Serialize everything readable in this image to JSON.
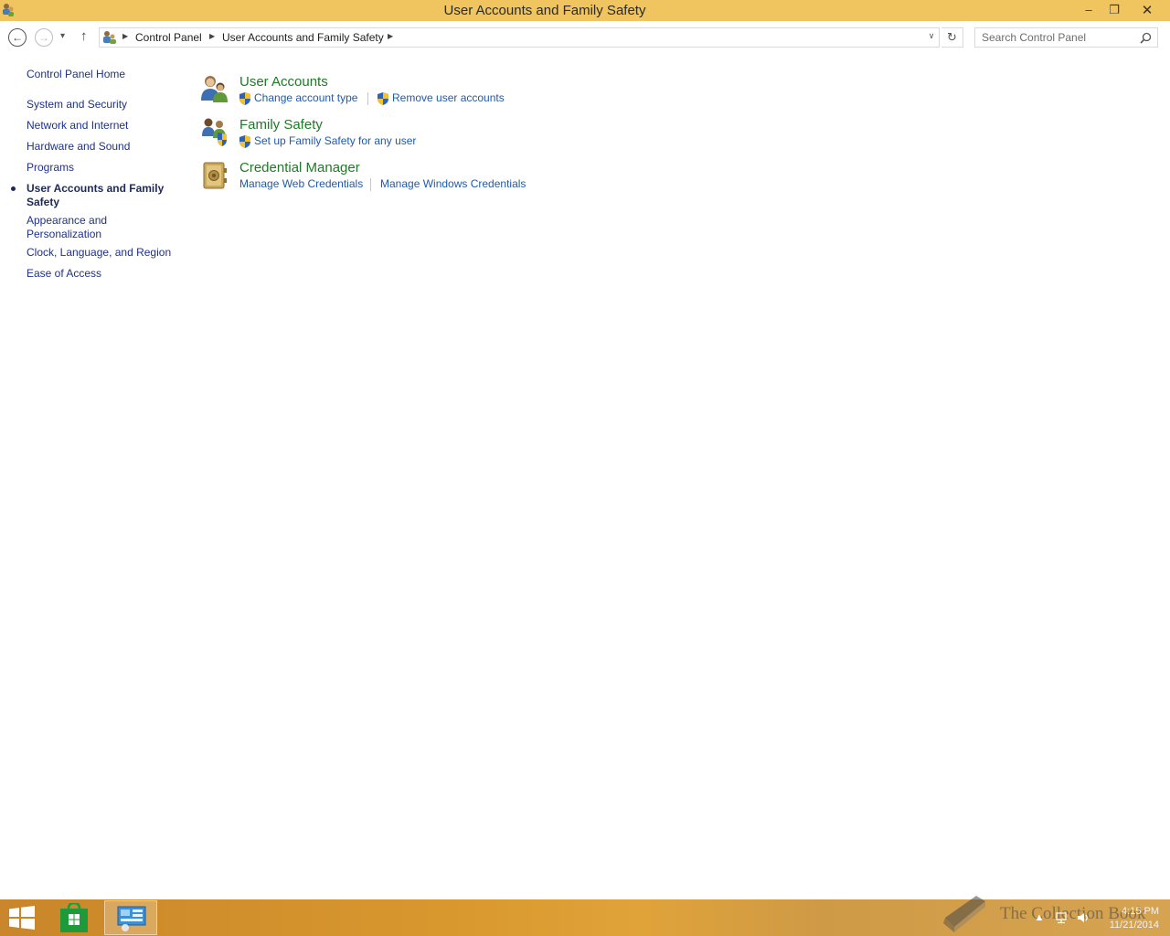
{
  "window": {
    "title": "User Accounts and Family Safety",
    "minimize_glyph": "–",
    "maximize_glyph": "❐",
    "close_glyph": "✕"
  },
  "navigation": {
    "back_glyph": "←",
    "forward_glyph": "→",
    "recent_glyph": "▾",
    "up_glyph": "↑",
    "refresh_glyph": "↻",
    "address_dropdown_glyph": "∨",
    "breadcrumbs": [
      "Control Panel",
      "User Accounts and Family Safety"
    ],
    "separator_glyph": "▶",
    "search_placeholder": "Search Control Panel"
  },
  "sidebar": {
    "items": [
      {
        "label": "Control Panel Home",
        "current": false
      },
      {
        "label": "System and Security",
        "current": false
      },
      {
        "label": "Network and Internet",
        "current": false
      },
      {
        "label": "Hardware and Sound",
        "current": false
      },
      {
        "label": "Programs",
        "current": false
      },
      {
        "label": "User Accounts and Family Safety",
        "current": true
      },
      {
        "label": "Appearance and Personalization",
        "current": false
      },
      {
        "label": "Clock, Language, and Region",
        "current": false
      },
      {
        "label": "Ease of Access",
        "current": false
      }
    ]
  },
  "categories": [
    {
      "title": "User Accounts",
      "icon": "user-accounts-icon",
      "tasks": [
        {
          "label": "Change account type",
          "shield": true
        },
        {
          "label": "Remove user accounts",
          "shield": true
        }
      ]
    },
    {
      "title": "Family Safety",
      "icon": "family-safety-icon",
      "tasks": [
        {
          "label": "Set up Family Safety for any user",
          "shield": true
        }
      ]
    },
    {
      "title": "Credential Manager",
      "icon": "credential-manager-icon",
      "tasks": [
        {
          "label": "Manage Web Credentials",
          "shield": false
        },
        {
          "label": "Manage Windows Credentials",
          "shield": false
        }
      ]
    }
  ],
  "taskbar": {
    "clock_time": "4:15 PM",
    "clock_date": "11/21/2014",
    "watermark": "The Collection Book",
    "apps": [
      "start-icon",
      "store-icon",
      "control-panel-icon"
    ]
  },
  "colors": {
    "title_bar": "#f0c45e",
    "category_title": "#1e7a26",
    "task_link": "#1e5aaf",
    "sidebar_link": "#1e3287"
  }
}
